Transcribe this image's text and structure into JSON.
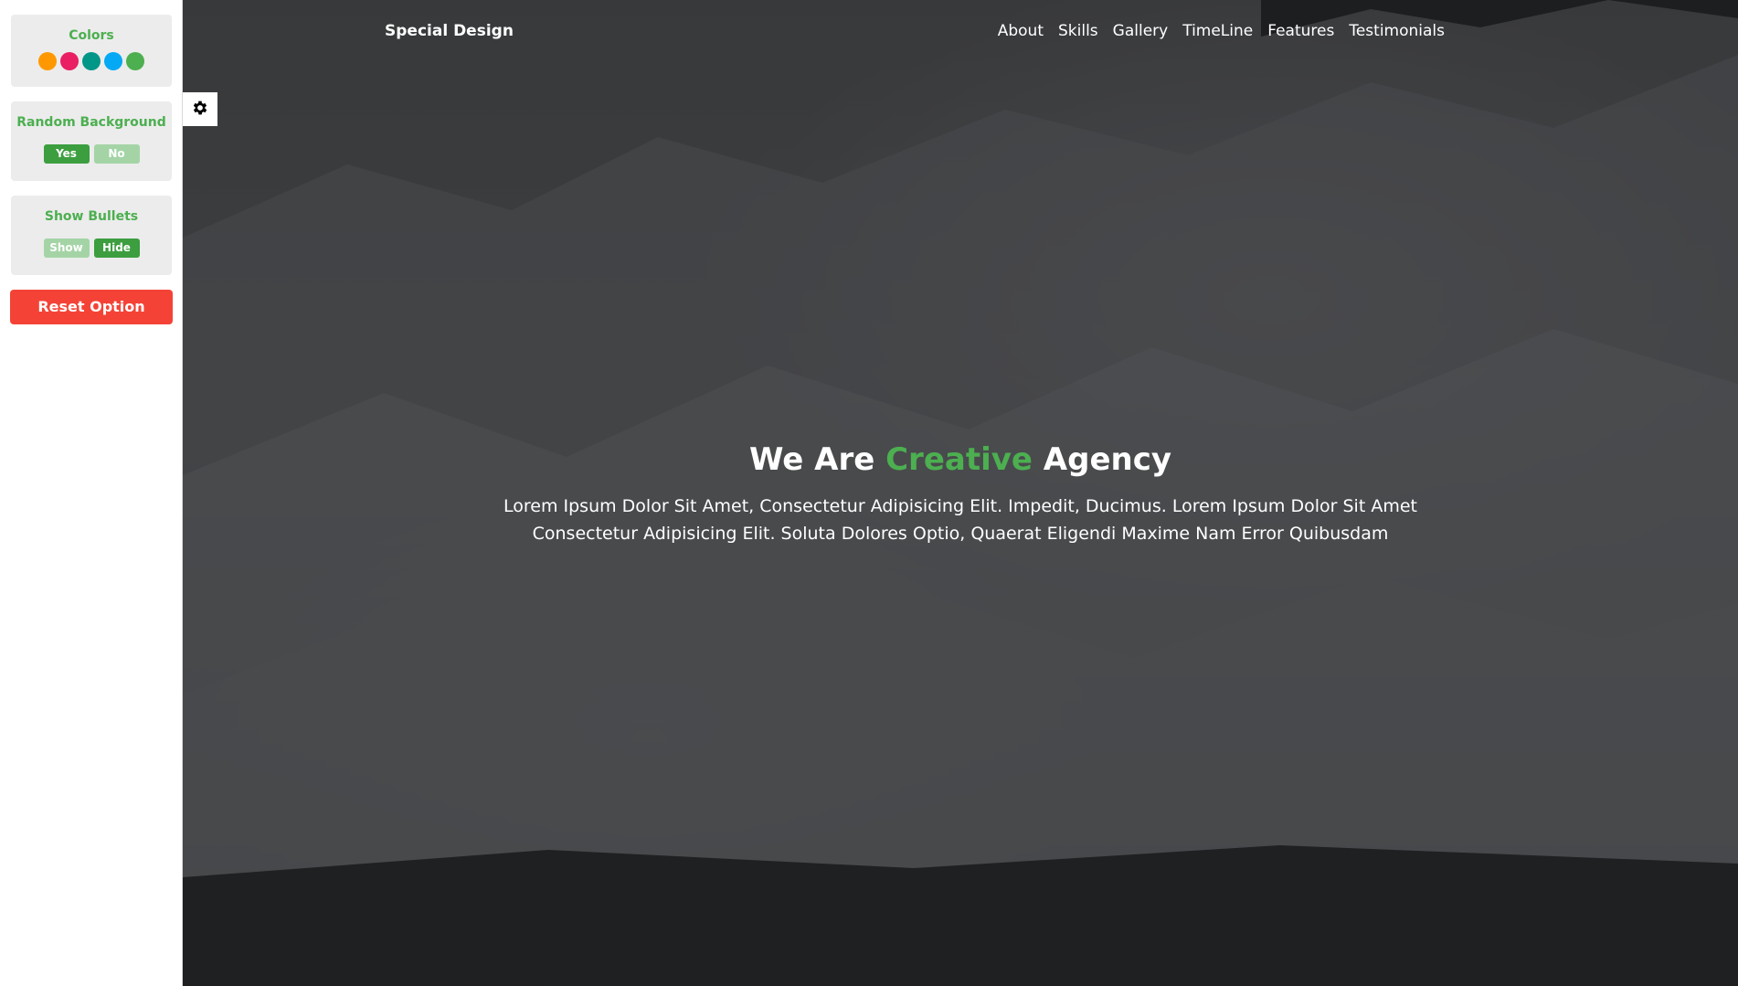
{
  "settings": {
    "colors_title": "Colors",
    "colors": [
      "#ff9800",
      "#e91e63",
      "#009688",
      "#03a9f4",
      "#4caf50"
    ],
    "random_background": {
      "title": "Random Background",
      "yes_label": "Yes",
      "no_label": "No",
      "selected": "Yes"
    },
    "show_bullets": {
      "title": "Show Bullets",
      "show_label": "Show",
      "hide_label": "Hide",
      "selected": "Hide"
    },
    "reset_label": "Reset Option",
    "toggle_icon": "gear-icon"
  },
  "header": {
    "logo": "Special Design",
    "nav": [
      "About",
      "Skills",
      "Gallery",
      "TimeLine",
      "Features",
      "Testimonials"
    ]
  },
  "intro": {
    "title_start": "We Are ",
    "title_accent": "Creative",
    "title_end": " Agency",
    "text": "Lorem Ipsum Dolor Sit Amet, Consectetur Adipisicing Elit. Impedit, Ducimus. Lorem Ipsum Dolor Sit Amet Consectetur Adipisicing Elit. Soluta Dolores Optio, Quaerat Eligendi Maxime Nam Error Quibusdam"
  },
  "theme": {
    "accent": "#4caf50",
    "reset": "#f44336"
  }
}
